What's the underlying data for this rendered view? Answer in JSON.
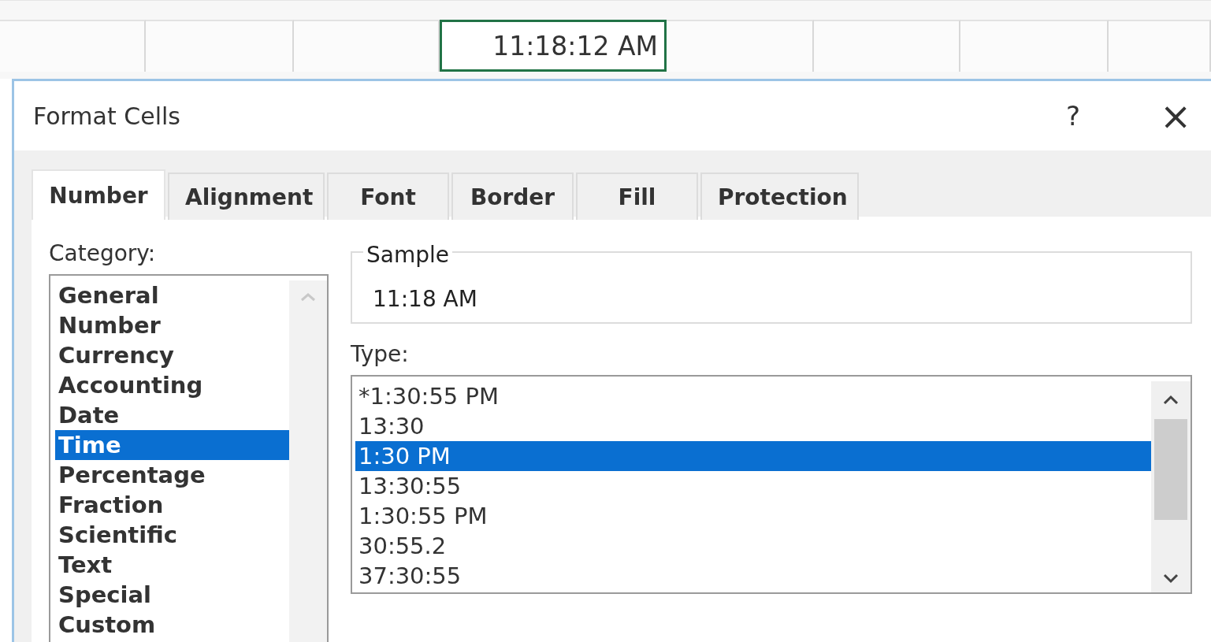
{
  "sheet": {
    "cells": [
      {
        "selected": false
      },
      {
        "selected": false
      },
      {
        "selected": false
      },
      {
        "value": "11:18:12 AM",
        "selected": true
      },
      {
        "selected": false
      },
      {
        "selected": false
      },
      {
        "selected": false
      },
      {
        "selected": false
      }
    ]
  },
  "dialog": {
    "title": "Format Cells",
    "help": "?",
    "close": "×",
    "tabs": [
      {
        "label": "Number",
        "selected": true
      },
      {
        "label": "Alignment",
        "selected": false
      },
      {
        "label": "Font",
        "selected": false
      },
      {
        "label": "Border",
        "selected": false
      },
      {
        "label": "Fill",
        "selected": false
      },
      {
        "label": "Protection",
        "selected": false
      }
    ],
    "category": {
      "label": "Category:",
      "items": [
        {
          "label": "General",
          "selected": false
        },
        {
          "label": "Number",
          "selected": false
        },
        {
          "label": "Currency",
          "selected": false
        },
        {
          "label": "Accounting",
          "selected": false
        },
        {
          "label": "Date",
          "selected": false
        },
        {
          "label": "Time",
          "selected": true
        },
        {
          "label": "Percentage",
          "selected": false
        },
        {
          "label": "Fraction",
          "selected": false
        },
        {
          "label": "Scientific",
          "selected": false
        },
        {
          "label": "Text",
          "selected": false
        },
        {
          "label": "Special",
          "selected": false
        },
        {
          "label": "Custom",
          "selected": false
        }
      ]
    },
    "sample": {
      "label": "Sample",
      "value": "11:18 AM"
    },
    "type": {
      "label": "Type:",
      "items": [
        {
          "label": "*1:30:55 PM",
          "selected": false
        },
        {
          "label": "13:30",
          "selected": false
        },
        {
          "label": "1:30 PM",
          "selected": true
        },
        {
          "label": "13:30:55",
          "selected": false
        },
        {
          "label": "1:30:55 PM",
          "selected": false
        },
        {
          "label": "30:55.2",
          "selected": false
        },
        {
          "label": "37:30:55",
          "selected": false
        }
      ]
    }
  }
}
